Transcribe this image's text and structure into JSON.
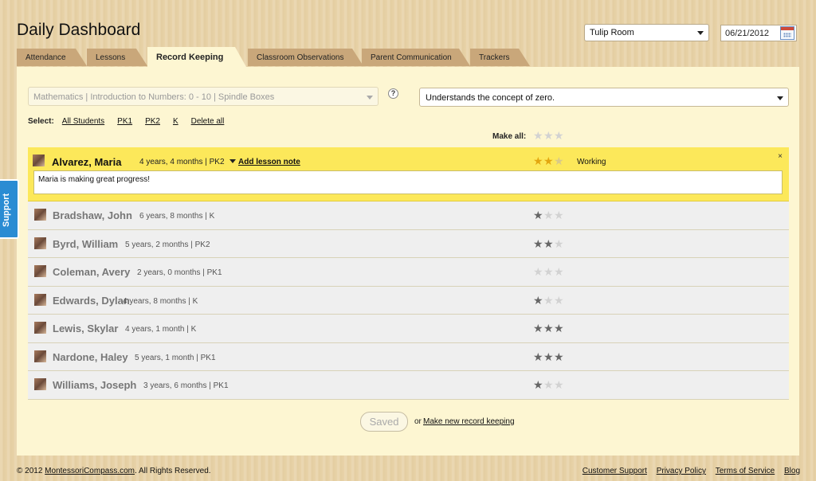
{
  "header": {
    "title": "Daily Dashboard",
    "room": "Tulip Room",
    "date": "06/21/2012"
  },
  "tabs": [
    {
      "label": "Attendance"
    },
    {
      "label": "Lessons"
    },
    {
      "label": "Record Keeping",
      "active": true
    },
    {
      "label": "Classroom Observations"
    },
    {
      "label": "Parent Communication"
    },
    {
      "label": "Trackers"
    }
  ],
  "filters": {
    "lesson": "Mathematics | Introduction to Numbers: 0 - 10 | Spindle Boxes",
    "help": "?",
    "concept": "Understands the concept of zero."
  },
  "select": {
    "label": "Select:",
    "options": [
      "All Students",
      "PK1",
      "PK2",
      "K",
      "Delete all"
    ]
  },
  "make_all": {
    "label": "Make all:",
    "stars": 0
  },
  "students": [
    {
      "name": "Alvarez, Maria",
      "meta": "4 years, 4 months | PK2",
      "stars": 2,
      "selected": true,
      "status": "Working",
      "note": "Maria is making great progress!",
      "add_note": "Add lesson note",
      "close": "×"
    },
    {
      "name": "Bradshaw, John",
      "meta": "6 years, 8 months | K",
      "stars": 1
    },
    {
      "name": "Byrd, William",
      "meta": "5 years, 2 months | PK2",
      "stars": 2
    },
    {
      "name": "Coleman, Avery",
      "meta": "2 years, 0 months | PK1",
      "stars": 0
    },
    {
      "name": "Edwards, Dylan",
      "meta": "4 years, 8 months | K",
      "stars": 1
    },
    {
      "name": "Lewis, Skylar",
      "meta": "4 years, 1 month | K",
      "stars": 3
    },
    {
      "name": "Nardone, Haley",
      "meta": "5 years, 1 month | PK1",
      "stars": 3
    },
    {
      "name": "Williams, Joseph",
      "meta": "3 years, 6 months | PK1",
      "stars": 1
    }
  ],
  "actions": {
    "saved": "Saved",
    "or": "or",
    "new_record": "Make new record keeping"
  },
  "support": "Support",
  "footer": {
    "copyright_prefix": "© 2012 ",
    "copyright_link": "MontessoriCompass.com",
    "copyright_suffix": ". All Rights Reserved.",
    "links": [
      "Customer Support",
      "Privacy Policy",
      "Terms of Service",
      "Blog"
    ]
  }
}
